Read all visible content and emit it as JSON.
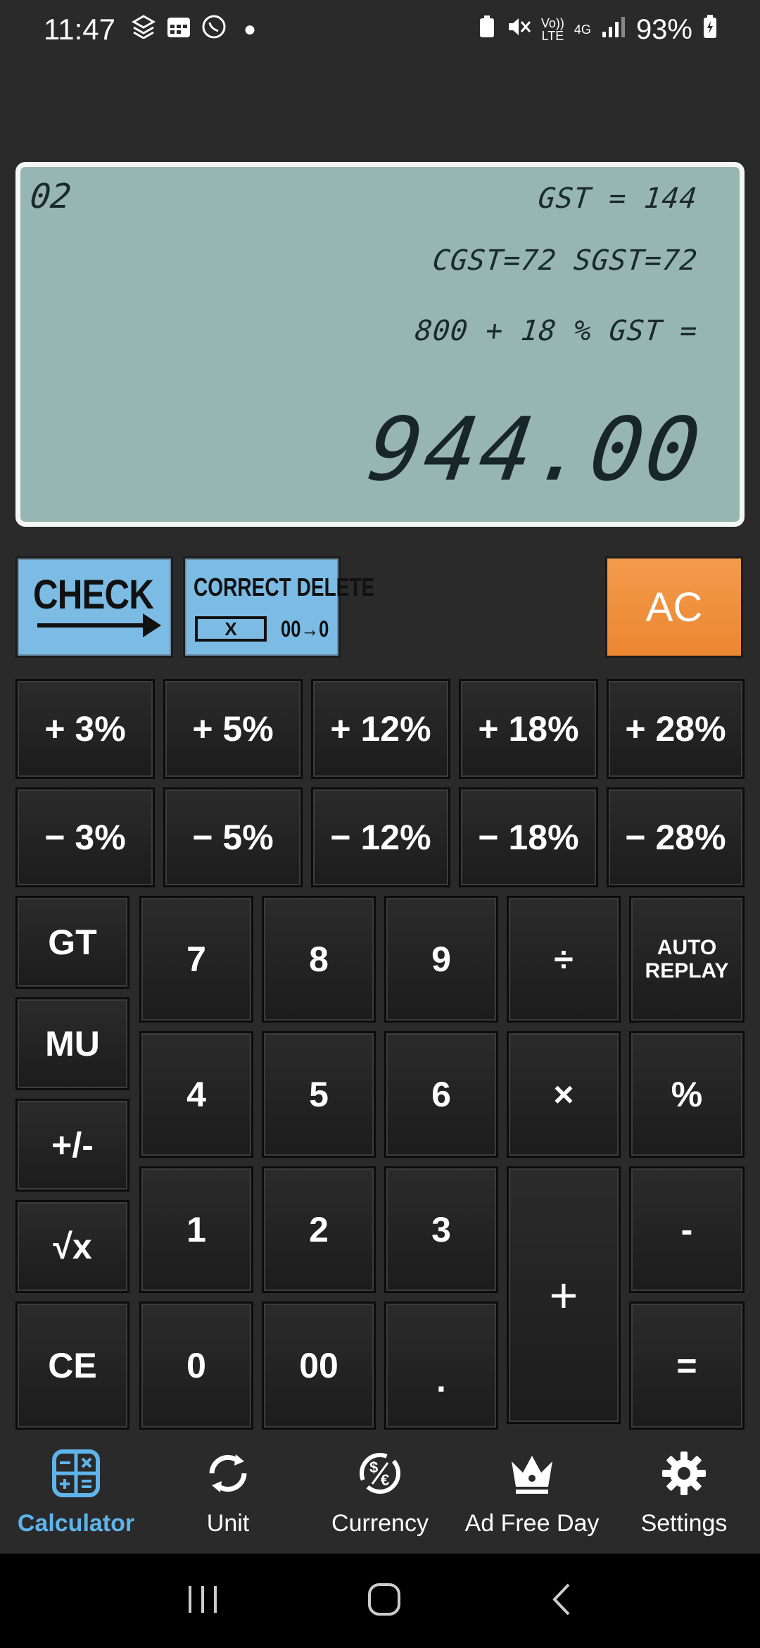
{
  "status": {
    "time": "11:47",
    "battery": "93%",
    "volte": "Vo) LTE",
    "net": "4G"
  },
  "display": {
    "count": "02",
    "line1": "GST = 144",
    "line2": "CGST=72 SGST=72",
    "line3": "800 + 18 % GST =",
    "result": "944.00"
  },
  "controls": {
    "check": "CHECK",
    "correct_delete": "CORRECT DELETE",
    "correct_box": "X",
    "delete_hint": "00→0",
    "ac": "AC"
  },
  "percent_keys": {
    "plus": [
      "+ 3%",
      "+ 5%",
      "+ 12%",
      "+ 18%",
      "+ 28%"
    ],
    "minus": [
      "− 3%",
      "− 5%",
      "− 12%",
      "− 18%",
      "− 28%"
    ]
  },
  "keys": {
    "gt": "GT",
    "mu": "MU",
    "plusminus": "+/-",
    "sqrt": "√x",
    "ce": "CE",
    "k7": "7",
    "k8": "8",
    "k9": "9",
    "div": "÷",
    "auto_replay": "AUTO REPLAY",
    "k4": "4",
    "k5": "5",
    "k6": "6",
    "mul": "×",
    "pct": "%",
    "k1": "1",
    "k2": "2",
    "k3": "3",
    "plus": "+",
    "minus": "-",
    "k0": "0",
    "k00": "00",
    "dot": ".",
    "eq": "="
  },
  "nav": {
    "calculator": "Calculator",
    "unit": "Unit",
    "currency": "Currency",
    "adfree": "Ad Free Day",
    "settings": "Settings"
  },
  "colors": {
    "accent": "#5fb4ea",
    "ac": "#ec8630",
    "display_bg": "#96b5b3"
  }
}
